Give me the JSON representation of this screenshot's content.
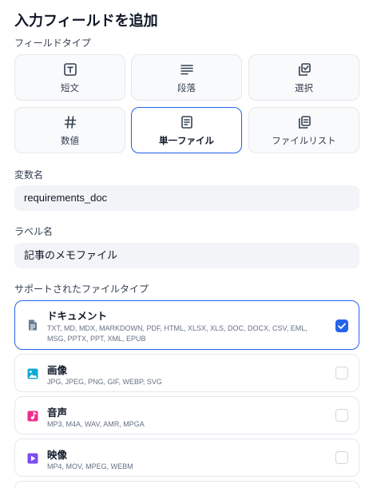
{
  "title": "入力フィールドを追加",
  "field_type": {
    "label": "フィールドタイプ",
    "options": [
      {
        "label": "短文",
        "icon": "text-input-icon",
        "selected": false
      },
      {
        "label": "段落",
        "icon": "paragraph-icon",
        "selected": false
      },
      {
        "label": "選択",
        "icon": "select-icon",
        "selected": false
      },
      {
        "label": "数値",
        "icon": "hash-icon",
        "selected": false
      },
      {
        "label": "単一ファイル",
        "icon": "file-icon",
        "selected": true
      },
      {
        "label": "ファイルリスト",
        "icon": "file-list-icon",
        "selected": false
      }
    ]
  },
  "variable": {
    "label": "変数名",
    "value": "requirements_doc"
  },
  "label_field": {
    "label": "ラベル名",
    "value": "記事のメモファイル"
  },
  "supported": {
    "label": "サポートされたファイルタイプ",
    "types": [
      {
        "name": "ドキュメント",
        "extensions": "TXT, MD, MDX, MARKDOWN, PDF, HTML, XLSX, XLS, DOC, DOCX, CSV, EML, MSG, PPTX, PPT, XML, EPUB",
        "icon": "document-icon",
        "color": "#6b7b95",
        "checked": true
      },
      {
        "name": "画像",
        "extensions": "JPG, JPEG, PNG, GIF, WEBP, SVG",
        "icon": "image-icon",
        "color": "#11a9d4",
        "checked": false
      },
      {
        "name": "音声",
        "extensions": "MP3, M4A, WAV, AMR, MPGA",
        "icon": "audio-icon",
        "color": "#ee2e8b",
        "checked": false
      },
      {
        "name": "映像",
        "extensions": "MP4, MOV, MPEG, WEBM",
        "icon": "video-icon",
        "color": "#7b4ff0",
        "checked": false
      }
    ]
  },
  "colors": {
    "accent": "#2563eb",
    "input_bg": "#f2f4f7",
    "card_bg": "#f9fafb",
    "border": "#e4e7ec"
  }
}
